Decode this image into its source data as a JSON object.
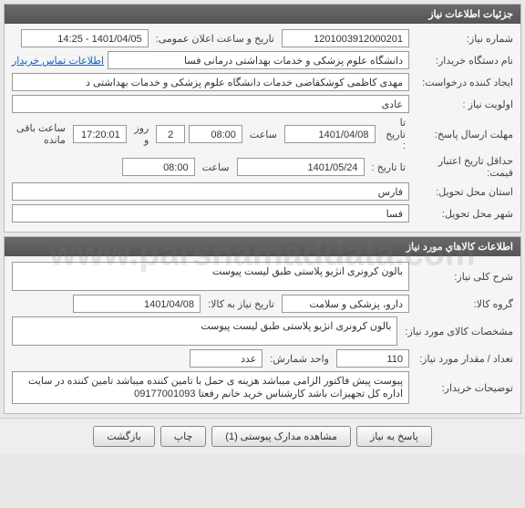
{
  "watermark": "www.parsnamaddata.com",
  "details_panel": {
    "title": "جزئیات اطلاعات نیاز",
    "need_number_label": "شماره نیاز:",
    "need_number": "1201003912000201",
    "announce_label": "تاریخ و ساعت اعلان عمومی:",
    "announce_value": "1401/04/05 - 14:25",
    "buyer_name_label": "نام دستگاه خریدار:",
    "buyer_name": "دانشگاه علوم پزشکی و خدمات بهداشتی درمانی فسا",
    "contact_link": "اطلاعات تماس خریدار",
    "requester_label": "ایجاد کننده درخواست:",
    "requester": "مهدی کاظمی کوشکقاضی خدمات دانشگاه علوم پزشکی و خدمات بهداشتی د",
    "priority_label": "اولویت نیاز :",
    "priority": "عادی",
    "reply_deadline_label": "مهلت ارسال پاسخ:",
    "to_date_label": "تا تاریخ :",
    "reply_date": "1401/04/08",
    "time_label": "ساعت",
    "reply_time": "08:00",
    "remain_days": "2",
    "remain_days_label": "روز و",
    "remain_time": "17:20:01",
    "remain_time_label": "ساعت باقی مانده",
    "valid_min_label": "حداقل تاریخ اعتبار",
    "valid_min_sub": "قیمت:",
    "valid_date": "1401/05/24",
    "valid_time": "08:00",
    "province_label": "استان محل تحویل:",
    "province": "فارس",
    "city_label": "شهر محل تحویل:",
    "city": "فسا"
  },
  "items_panel": {
    "title": "اطلاعات کالاهاي مورد نیاز",
    "desc_label": "شرح کلی نیاز:",
    "desc": "بالون کرونری انژیو پلاستی طبق لیست پیوست",
    "group_label": "گروه کالا:",
    "group": "دارو، پزشکی و سلامت",
    "need_date_label": "تاریخ نیاز به کالا:",
    "need_date": "1401/04/08",
    "spec_label": "مشخصات کالای مورد نیاز:",
    "spec": "بالون کرونری انژیو پلاستی طبق لیست پیوست",
    "qty_label": "تعداد / مقدار مورد نیاز:",
    "qty": "110",
    "unit_label": "واحد شمارش:",
    "unit": "عدد",
    "notes_label": "توضیحات خریدار:",
    "notes": "پیوست پیش فاکتور الزامی میباشد هزینه ی حمل با تامین کننده میباشد تامین کننده در سایت اداره کل تجهیزات باشد کارشناس خرید خانم رفعتا 09177001093"
  },
  "buttons": {
    "reply": "پاسخ به نیاز",
    "attachments": "مشاهده مدارک پیوستی (1)",
    "print": "چاپ",
    "back": "بازگشت"
  }
}
